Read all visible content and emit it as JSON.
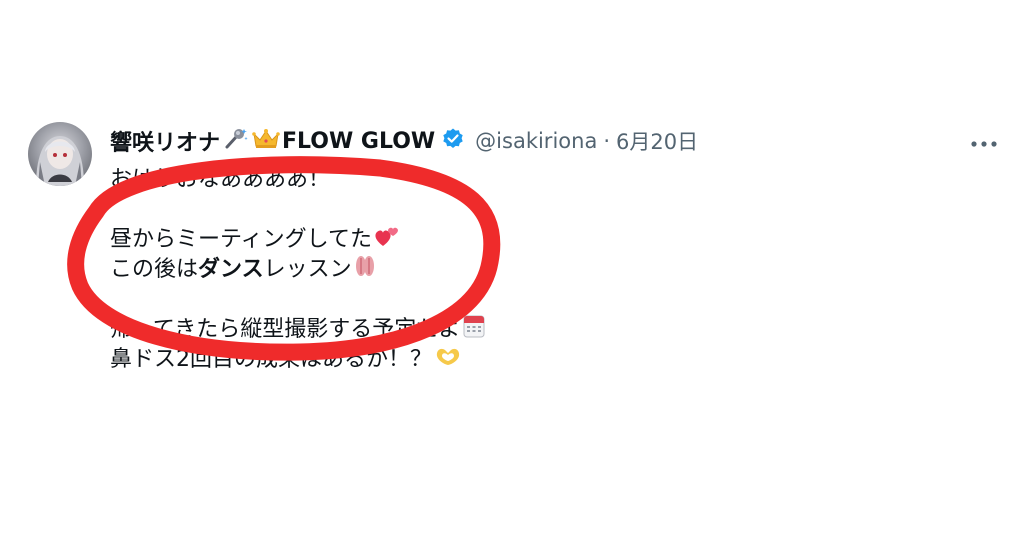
{
  "tweet": {
    "display_name": "響咲リオナ",
    "group_name": "FLOW GLOW",
    "handle": "@isakiriona",
    "separator": "·",
    "date": "6月20日",
    "lines": {
      "l1": "おはりおなああああ！",
      "l2": "昼からミーティングしてた",
      "l3_a": "この後は",
      "l3_b": "ダンス",
      "l3_c": "レッスン",
      "l4": "帰ってきたら縦型撮影する予定だよ",
      "l5": "鼻ドス2回目の成果はあるか！？"
    },
    "icons": [
      "microphone-sparkles-icon",
      "crown-icon",
      "verified-badge-icon",
      "more-icon",
      "two-hearts-icon",
      "kiss-mark-icon",
      "calendar-icon",
      "heart-hands-icon"
    ]
  },
  "colors": {
    "verified": "#1d9bf0",
    "annotation": "#ef2b2b",
    "secondary_text": "#536471"
  }
}
